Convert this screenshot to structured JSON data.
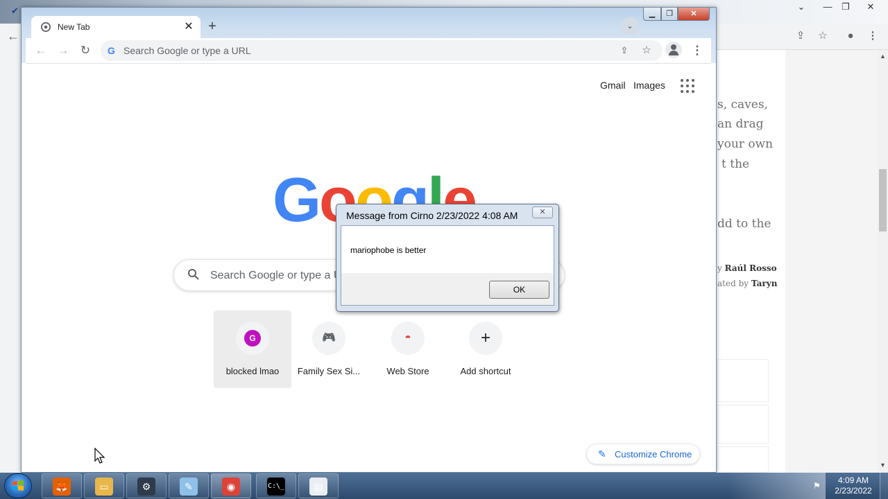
{
  "background_window": {
    "text_lines": [
      "s, caves,",
      "an drag",
      "your own",
      "t the",
      "dd to the"
    ],
    "byline_1_prefix": "y",
    "byline_1_name": "Raúl Rosso",
    "byline_2_prefix": "ated by",
    "byline_2_name": "Taryn"
  },
  "browser": {
    "tab_title": "New Tab",
    "omnibox_placeholder": "Search Google or type a URL",
    "icons": {
      "back": "←",
      "forward": "→",
      "reload": "↻",
      "share": "⇪",
      "star": "☆",
      "menu": "⋮",
      "close": "✕",
      "new_tab": "+",
      "tab_search": "⌄"
    }
  },
  "new_tab_page": {
    "top_links": {
      "gmail": "Gmail",
      "images": "Images"
    },
    "logo": [
      {
        "letter": "G",
        "color": "#4285f4"
      },
      {
        "letter": "o",
        "color": "#ea4335"
      },
      {
        "letter": "o",
        "color": "#fbbc05"
      },
      {
        "letter": "g",
        "color": "#4285f4"
      },
      {
        "letter": "l",
        "color": "#34a853"
      },
      {
        "letter": "e",
        "color": "#ea4335"
      }
    ],
    "search_placeholder": "Search Google or type a URL",
    "shortcuts": [
      {
        "label": "blocked lmao",
        "icon": "G"
      },
      {
        "label": "Family Sex Si...",
        "icon": "🎮"
      },
      {
        "label": "Web Store",
        "icon": "◓"
      },
      {
        "label": "Add shortcut",
        "icon": "+"
      }
    ],
    "customize_label": "Customize Chrome",
    "customize_icon": "✎"
  },
  "dialog": {
    "title": "Message from Cirno 2/23/2022 4:08 AM",
    "message": "mariophobe is better",
    "ok_label": "OK",
    "close_icon": "✕"
  },
  "taskbar": {
    "apps": [
      {
        "name": "firefox",
        "glyph": "🦊",
        "color": "#e66000"
      },
      {
        "name": "file-explorer",
        "glyph": "▭",
        "color": "#e8b64a"
      },
      {
        "name": "settings-tool",
        "glyph": "⚙",
        "color": "#2f3b4a"
      },
      {
        "name": "notes",
        "glyph": "✎",
        "color": "#8fc1e8"
      },
      {
        "name": "chrome",
        "glyph": "◉",
        "color": "#db4437"
      },
      {
        "name": "command-prompt",
        "glyph": "C:\\_",
        "color": "#000000"
      },
      {
        "name": "document-viewer",
        "glyph": "▤",
        "color": "#e9eef3"
      }
    ],
    "clock_time": "4:09 AM",
    "clock_date": "2/23/2022"
  }
}
